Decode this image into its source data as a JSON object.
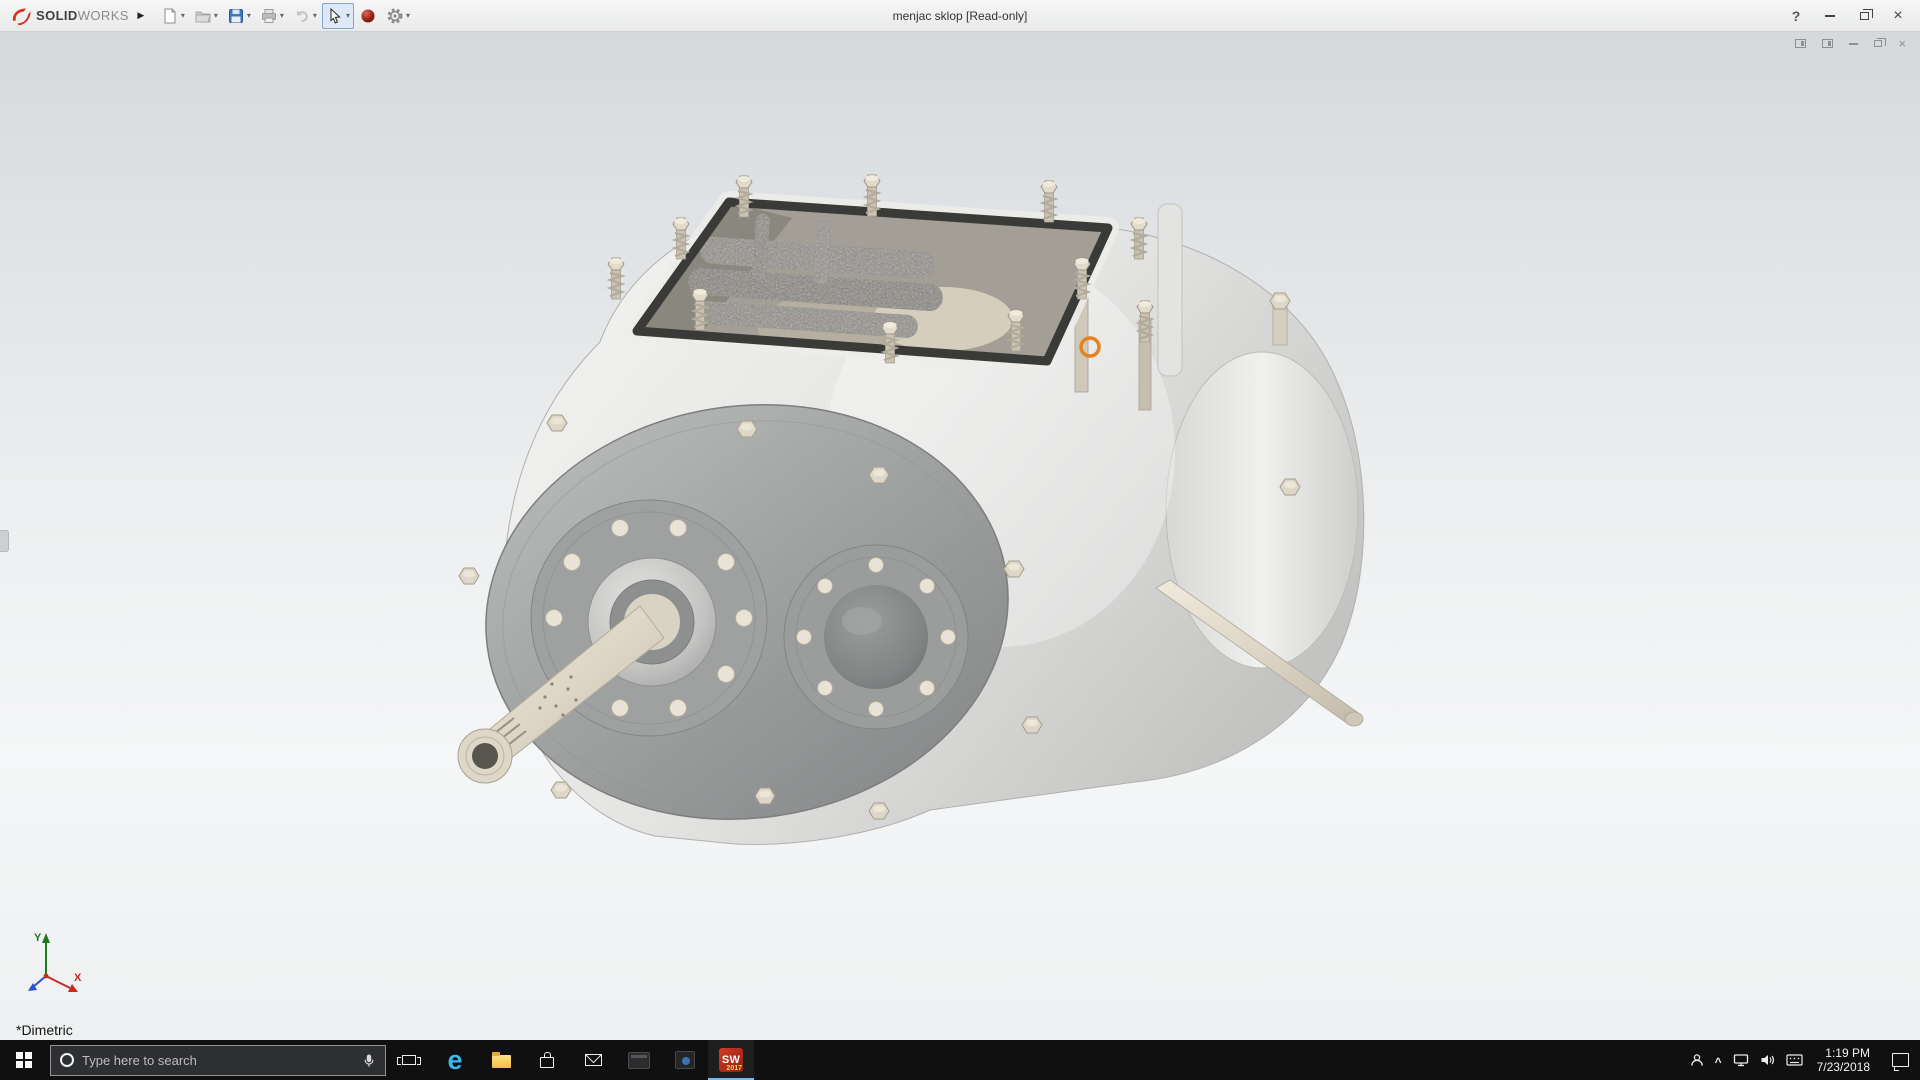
{
  "titlebar": {
    "logo_part1": "SOLID",
    "logo_part2": "WORKS",
    "document_title": "menjac sklop [Read-only]"
  },
  "icons": {
    "expand_arrow": "▶",
    "dropdown_caret": "▾",
    "help": "?",
    "close": "×",
    "edge_glyph": "e",
    "tray_chevron": "^"
  },
  "toolbar": {
    "items": [
      "new-document",
      "open",
      "save",
      "print",
      "undo",
      "select",
      "appearance-sphere",
      "options-gear"
    ],
    "active_tool": "select"
  },
  "doc_window": {
    "controls": [
      "pane-left",
      "pane-right",
      "minimize",
      "restore",
      "close"
    ]
  },
  "viewport": {
    "view_label": "*Dimetric",
    "triad_y_label": "Y",
    "triad_x_label": "X",
    "model_name": "gearbox-assembly",
    "selection_marker_color": "#e8821e"
  },
  "taskbar": {
    "search_placeholder": "Type here to search",
    "apps": [
      "task-view",
      "edge",
      "file-explorer",
      "store",
      "mail",
      "pinned-app-1",
      "pinned-app-2",
      "solidworks-2017"
    ],
    "solidworks_label": "SW",
    "solidworks_year": "2017",
    "time": "1:19 PM",
    "date": "7/23/2018"
  },
  "colors": {
    "taskbar_background": "#101010",
    "titlebar_background": "#efefef",
    "accent_blue": "#3a78c2",
    "solidworks_red": "#d6331c",
    "viewport_top": "#d6d9dc",
    "viewport_bottom": "#eef0f1"
  }
}
